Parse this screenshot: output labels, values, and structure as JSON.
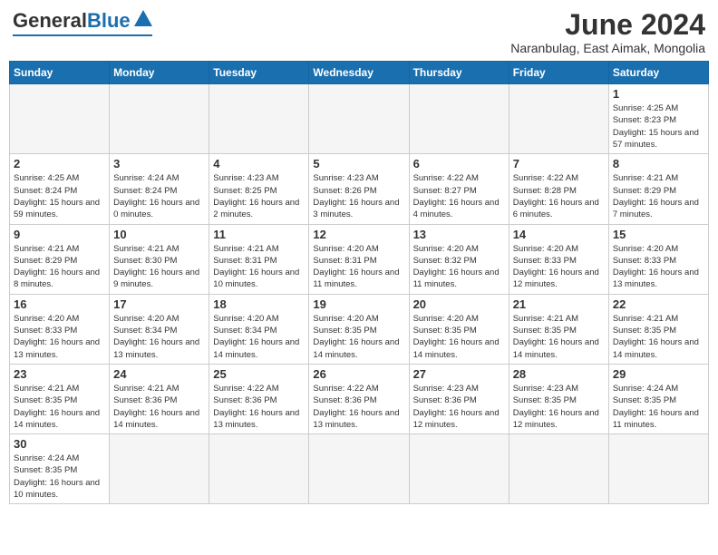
{
  "logo": {
    "general": "General",
    "blue": "Blue"
  },
  "title": {
    "month_year": "June 2024",
    "location": "Naranbulag, East Aimak, Mongolia"
  },
  "headers": [
    "Sunday",
    "Monday",
    "Tuesday",
    "Wednesday",
    "Thursday",
    "Friday",
    "Saturday"
  ],
  "days": [
    {
      "date": "",
      "info": ""
    },
    {
      "date": "",
      "info": ""
    },
    {
      "date": "",
      "info": ""
    },
    {
      "date": "",
      "info": ""
    },
    {
      "date": "",
      "info": ""
    },
    {
      "date": "",
      "info": ""
    },
    {
      "date": "1",
      "info": "Sunrise: 4:25 AM\nSunset: 8:23 PM\nDaylight: 15 hours and 57 minutes."
    }
  ],
  "week2": [
    {
      "date": "2",
      "info": "Sunrise: 4:25 AM\nSunset: 8:24 PM\nDaylight: 15 hours and 59 minutes."
    },
    {
      "date": "3",
      "info": "Sunrise: 4:24 AM\nSunset: 8:24 PM\nDaylight: 16 hours and 0 minutes."
    },
    {
      "date": "4",
      "info": "Sunrise: 4:23 AM\nSunset: 8:25 PM\nDaylight: 16 hours and 2 minutes."
    },
    {
      "date": "5",
      "info": "Sunrise: 4:23 AM\nSunset: 8:26 PM\nDaylight: 16 hours and 3 minutes."
    },
    {
      "date": "6",
      "info": "Sunrise: 4:22 AM\nSunset: 8:27 PM\nDaylight: 16 hours and 4 minutes."
    },
    {
      "date": "7",
      "info": "Sunrise: 4:22 AM\nSunset: 8:28 PM\nDaylight: 16 hours and 6 minutes."
    },
    {
      "date": "8",
      "info": "Sunrise: 4:21 AM\nSunset: 8:29 PM\nDaylight: 16 hours and 7 minutes."
    }
  ],
  "week3": [
    {
      "date": "9",
      "info": "Sunrise: 4:21 AM\nSunset: 8:29 PM\nDaylight: 16 hours and 8 minutes."
    },
    {
      "date": "10",
      "info": "Sunrise: 4:21 AM\nSunset: 8:30 PM\nDaylight: 16 hours and 9 minutes."
    },
    {
      "date": "11",
      "info": "Sunrise: 4:21 AM\nSunset: 8:31 PM\nDaylight: 16 hours and 10 minutes."
    },
    {
      "date": "12",
      "info": "Sunrise: 4:20 AM\nSunset: 8:31 PM\nDaylight: 16 hours and 11 minutes."
    },
    {
      "date": "13",
      "info": "Sunrise: 4:20 AM\nSunset: 8:32 PM\nDaylight: 16 hours and 11 minutes."
    },
    {
      "date": "14",
      "info": "Sunrise: 4:20 AM\nSunset: 8:33 PM\nDaylight: 16 hours and 12 minutes."
    },
    {
      "date": "15",
      "info": "Sunrise: 4:20 AM\nSunset: 8:33 PM\nDaylight: 16 hours and 13 minutes."
    }
  ],
  "week4": [
    {
      "date": "16",
      "info": "Sunrise: 4:20 AM\nSunset: 8:33 PM\nDaylight: 16 hours and 13 minutes."
    },
    {
      "date": "17",
      "info": "Sunrise: 4:20 AM\nSunset: 8:34 PM\nDaylight: 16 hours and 13 minutes."
    },
    {
      "date": "18",
      "info": "Sunrise: 4:20 AM\nSunset: 8:34 PM\nDaylight: 16 hours and 14 minutes."
    },
    {
      "date": "19",
      "info": "Sunrise: 4:20 AM\nSunset: 8:35 PM\nDaylight: 16 hours and 14 minutes."
    },
    {
      "date": "20",
      "info": "Sunrise: 4:20 AM\nSunset: 8:35 PM\nDaylight: 16 hours and 14 minutes."
    },
    {
      "date": "21",
      "info": "Sunrise: 4:21 AM\nSunset: 8:35 PM\nDaylight: 16 hours and 14 minutes."
    },
    {
      "date": "22",
      "info": "Sunrise: 4:21 AM\nSunset: 8:35 PM\nDaylight: 16 hours and 14 minutes."
    }
  ],
  "week5": [
    {
      "date": "23",
      "info": "Sunrise: 4:21 AM\nSunset: 8:35 PM\nDaylight: 16 hours and 14 minutes."
    },
    {
      "date": "24",
      "info": "Sunrise: 4:21 AM\nSunset: 8:36 PM\nDaylight: 16 hours and 14 minutes."
    },
    {
      "date": "25",
      "info": "Sunrise: 4:22 AM\nSunset: 8:36 PM\nDaylight: 16 hours and 13 minutes."
    },
    {
      "date": "26",
      "info": "Sunrise: 4:22 AM\nSunset: 8:36 PM\nDaylight: 16 hours and 13 minutes."
    },
    {
      "date": "27",
      "info": "Sunrise: 4:23 AM\nSunset: 8:36 PM\nDaylight: 16 hours and 12 minutes."
    },
    {
      "date": "28",
      "info": "Sunrise: 4:23 AM\nSunset: 8:35 PM\nDaylight: 16 hours and 12 minutes."
    },
    {
      "date": "29",
      "info": "Sunrise: 4:24 AM\nSunset: 8:35 PM\nDaylight: 16 hours and 11 minutes."
    }
  ],
  "week6": [
    {
      "date": "30",
      "info": "Sunrise: 4:24 AM\nSunset: 8:35 PM\nDaylight: 16 hours and 10 minutes."
    },
    {
      "date": "",
      "info": ""
    },
    {
      "date": "",
      "info": ""
    },
    {
      "date": "",
      "info": ""
    },
    {
      "date": "",
      "info": ""
    },
    {
      "date": "",
      "info": ""
    },
    {
      "date": "",
      "info": ""
    }
  ]
}
